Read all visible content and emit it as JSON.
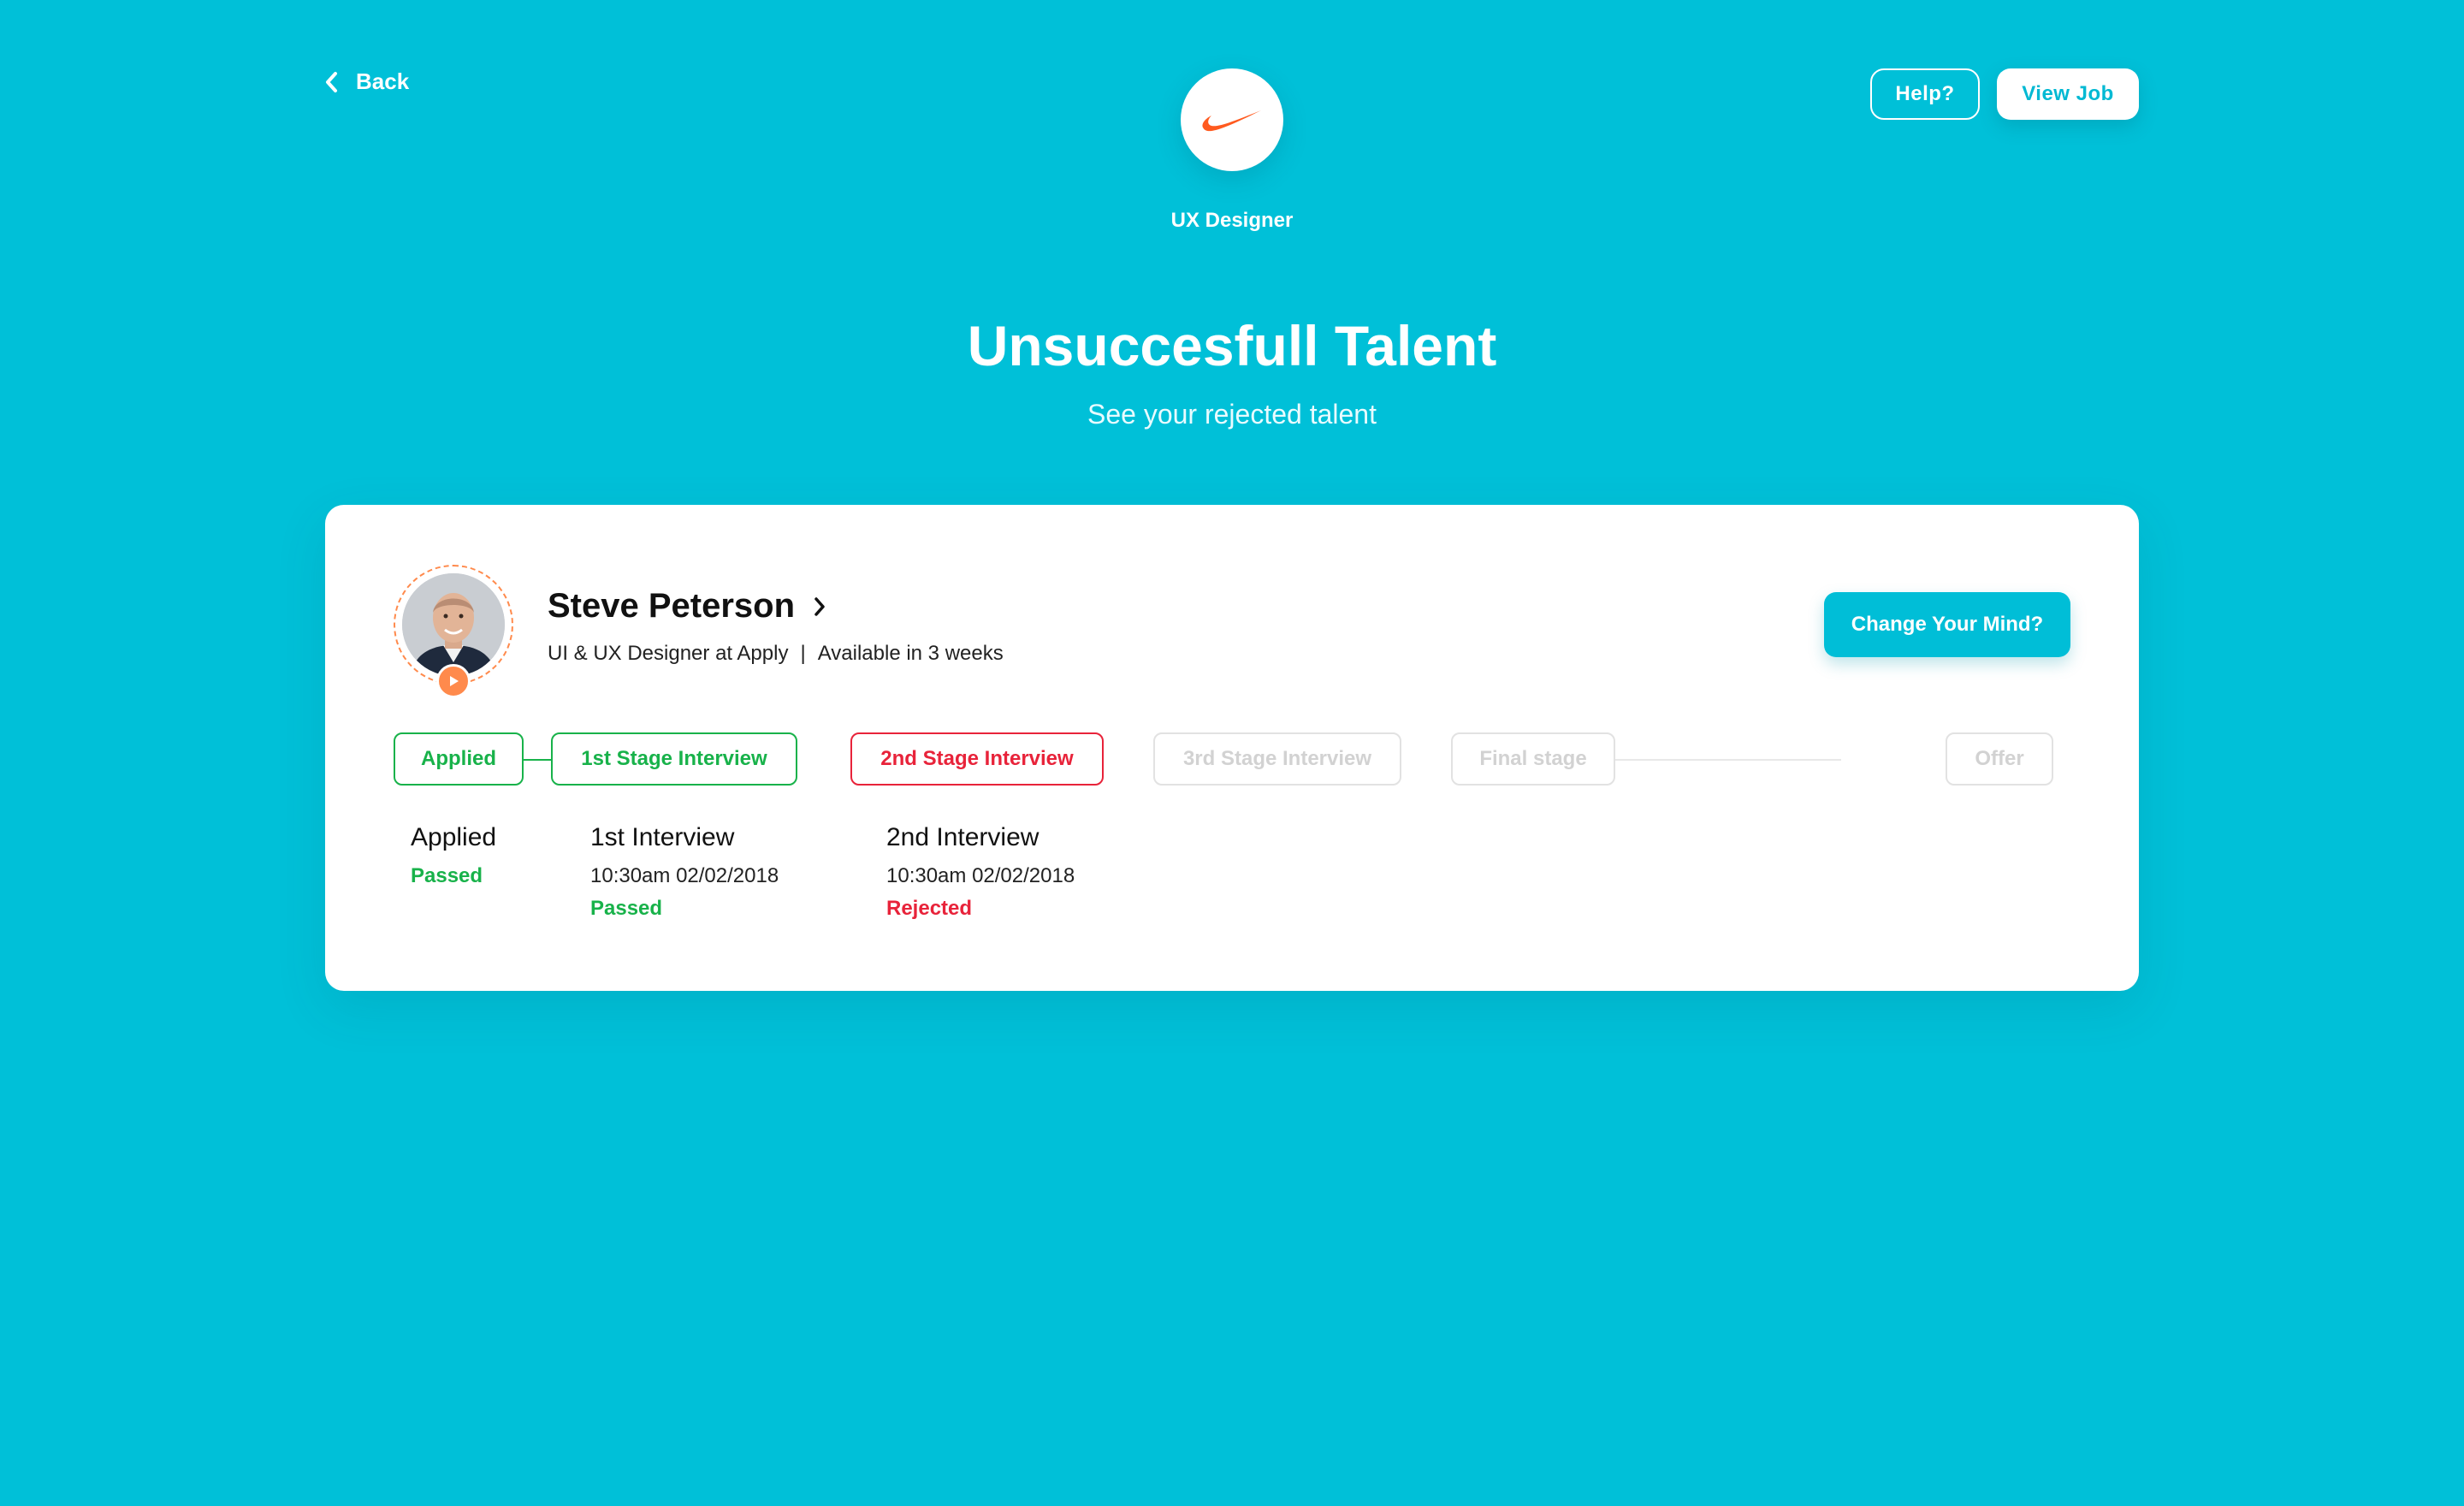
{
  "nav": {
    "back_label": "Back"
  },
  "company": {
    "job_title": "UX Designer",
    "logo_icon": "swoosh-logo",
    "logo_color": "#ff5a1f"
  },
  "header_buttons": {
    "help_label": "Help?",
    "view_job_label": "View Job"
  },
  "hero": {
    "title": "Unsuccesfull Talent",
    "subtitle": "See your rejected talent"
  },
  "candidate": {
    "name": "Steve Peterson",
    "role": "UI & UX Designer at Apply",
    "separator": "|",
    "availability": "Available in 3 weeks",
    "change_mind_label": "Change Your Mind?"
  },
  "stages": [
    {
      "label": "Applied",
      "state": "passed"
    },
    {
      "label": "1st Stage Interview",
      "state": "passed"
    },
    {
      "label": "2nd Stage Interview",
      "state": "rejected"
    },
    {
      "label": "3rd Stage Interview",
      "state": "pending"
    },
    {
      "label": "Final stage",
      "state": "pending"
    },
    {
      "label": "Offer",
      "state": "pending"
    }
  ],
  "details": [
    {
      "title": "Applied",
      "time": "",
      "status": "Passed"
    },
    {
      "title": "1st Interview",
      "time": "10:30am 02/02/2018",
      "status": "Passed"
    },
    {
      "title": "2nd Interview",
      "time": "10:30am 02/02/2018",
      "status": "Rejected"
    }
  ],
  "colors": {
    "background": "#00c0d8",
    "passed": "#18b24a",
    "rejected": "#e8233a",
    "pending": "#e2e2e2",
    "accent": "#ff8a4c"
  }
}
